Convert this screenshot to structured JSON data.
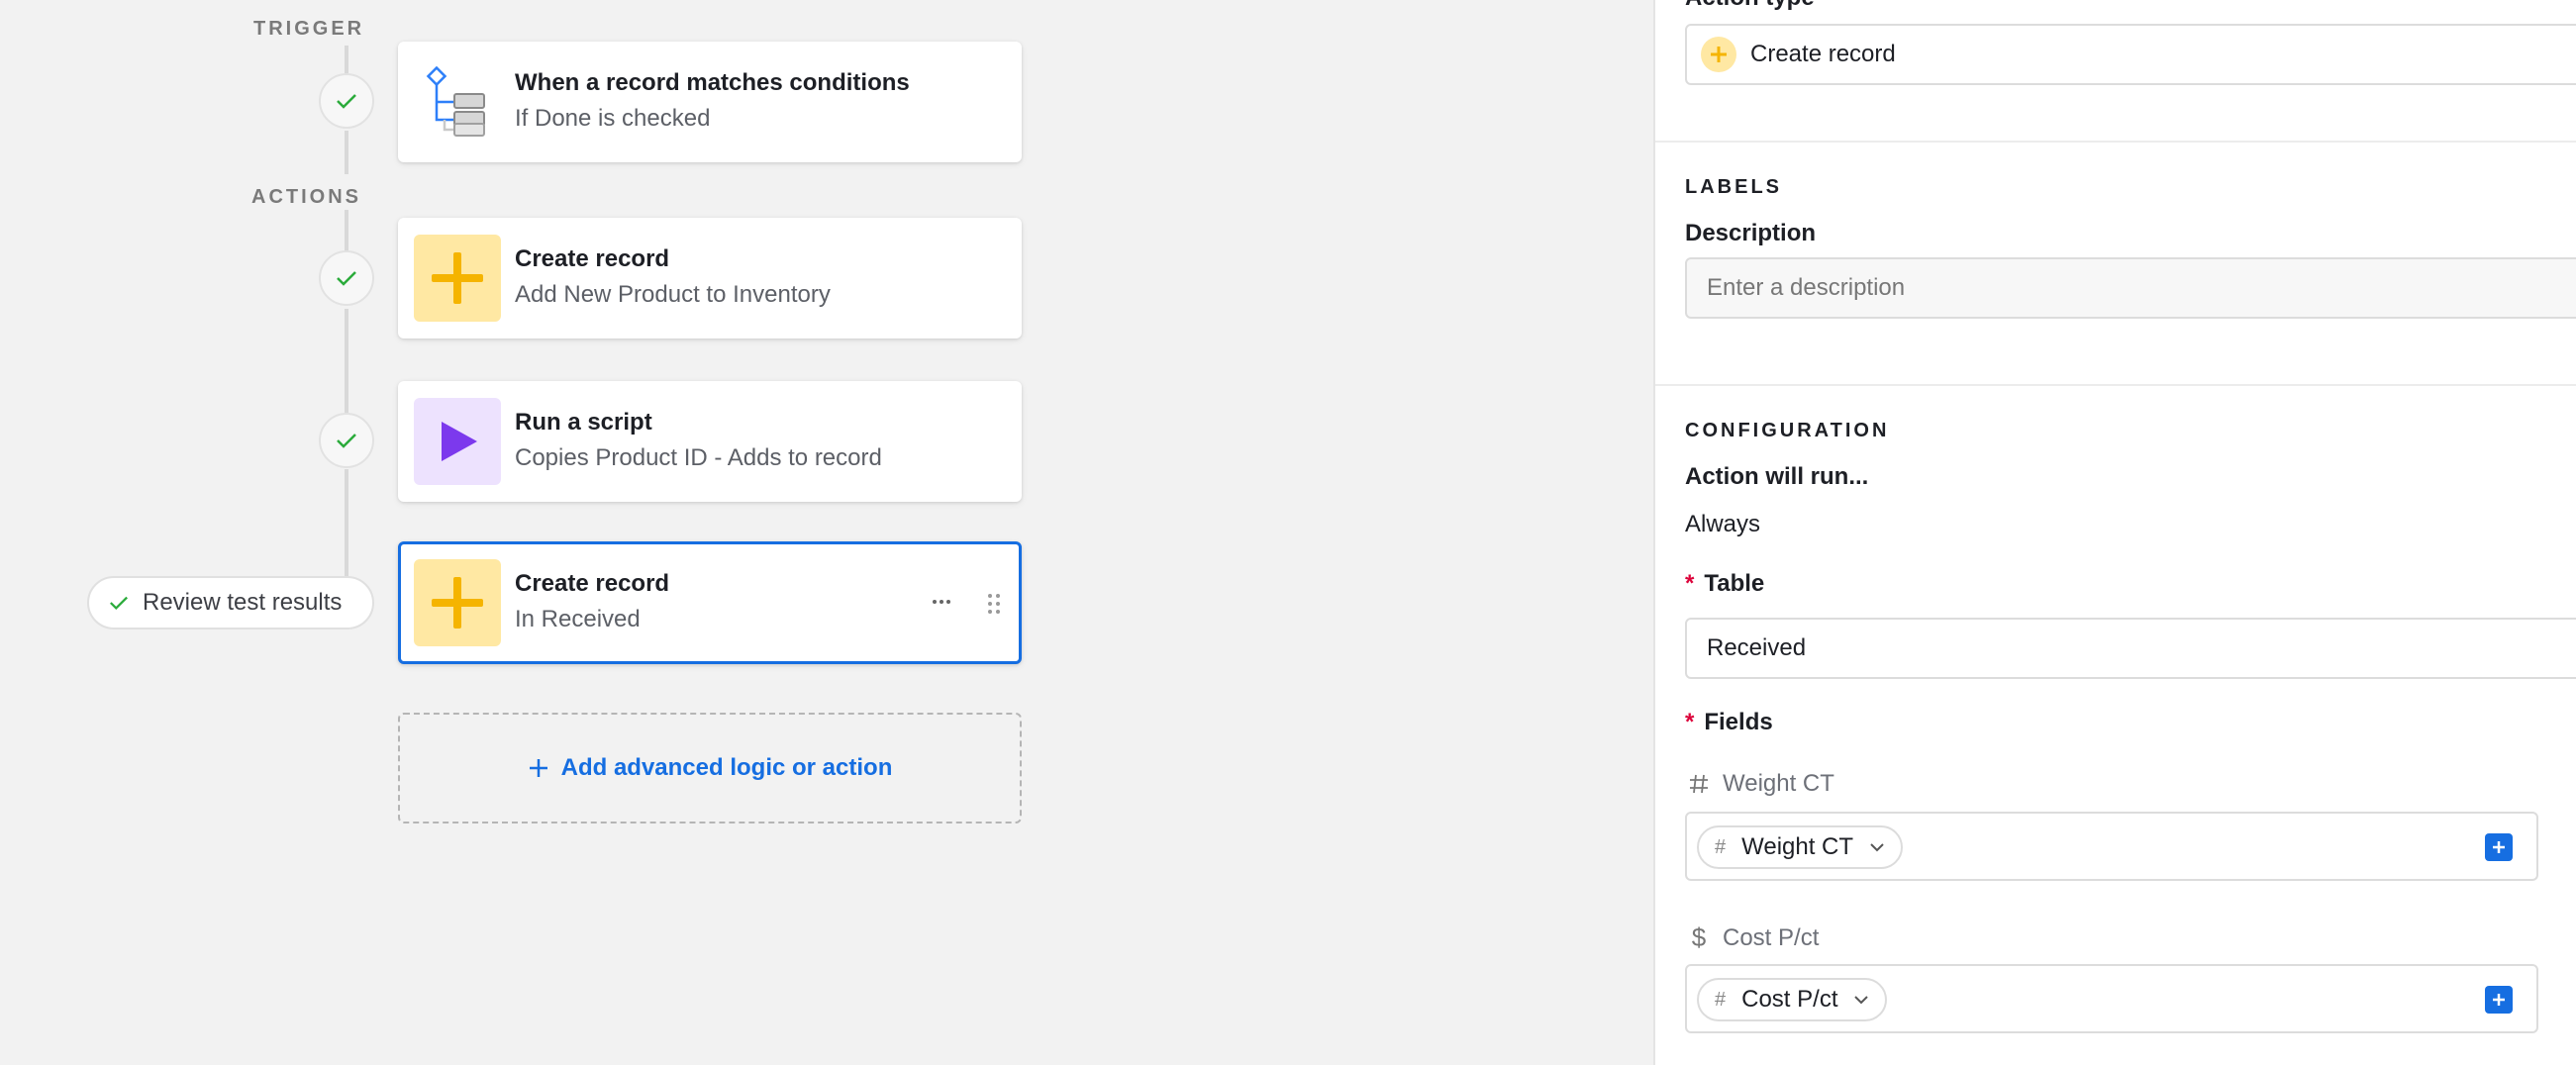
{
  "flow": {
    "trigger_label": "TRIGGER",
    "actions_label": "ACTIONS",
    "trigger_card": {
      "title": "When a record matches conditions",
      "subtitle": "If Done is checked",
      "icon": "conditions-tree-icon"
    },
    "action_cards": [
      {
        "title": "Create record",
        "subtitle": "Add New Product to Inventory",
        "icon": "plus-icon"
      },
      {
        "title": "Run a script",
        "subtitle": "Copies Product ID - Adds to record",
        "icon": "play-icon"
      },
      {
        "title": "Create record",
        "subtitle": "In Received",
        "icon": "plus-icon",
        "selected": true
      }
    ],
    "review_button": "Review test results",
    "add_action": "Add advanced logic or action"
  },
  "panel": {
    "action_type_label": "Action type",
    "action_type_value": "Create record",
    "labels_heading": "LABELS",
    "description_label": "Description",
    "description_placeholder": "Enter a description",
    "configuration_heading": "CONFIGURATION",
    "action_will_run_label": "Action will run...",
    "action_will_run_value": "Always",
    "table_label": "Table",
    "table_value": "Received",
    "fields_label": "Fields",
    "fields": [
      {
        "label": "Weight CT",
        "type_icon": "hash-icon",
        "token": "Weight CT"
      },
      {
        "label": "Cost P/ct",
        "type_icon": "dollar-icon",
        "token": "Cost P/ct"
      }
    ],
    "required_marker": "*"
  },
  "colors": {
    "accent": "#166ee1",
    "create_icon_bg": "#ffe8a3",
    "create_icon_fg": "#f5b400",
    "script_icon_bg": "#ede2fe",
    "script_icon_fg": "#7c39ed",
    "check": "#20c933",
    "required": "#dc043b"
  }
}
